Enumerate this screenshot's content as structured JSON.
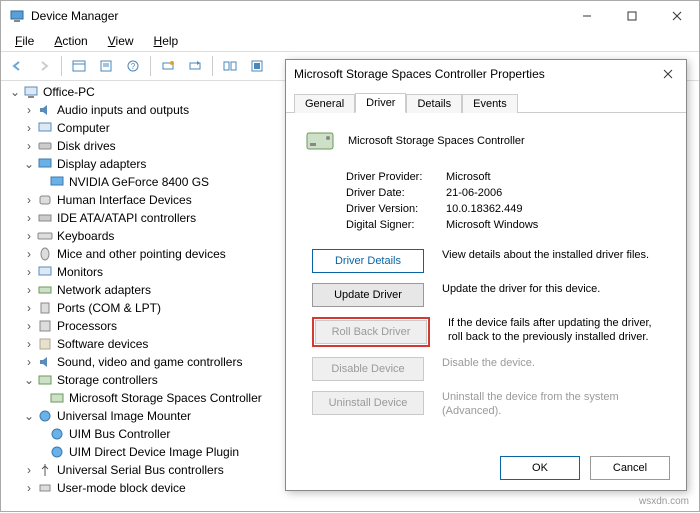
{
  "window": {
    "title": "Device Manager"
  },
  "menubar": {
    "file": "File",
    "action": "Action",
    "view": "View",
    "help": "Help"
  },
  "tree": {
    "root": "Office-PC",
    "items": [
      "Audio inputs and outputs",
      "Computer",
      "Disk drives",
      "Display adapters",
      "NVIDIA GeForce 8400 GS",
      "Human Interface Devices",
      "IDE ATA/ATAPI controllers",
      "Keyboards",
      "Mice and other pointing devices",
      "Monitors",
      "Network adapters",
      "Ports (COM & LPT)",
      "Processors",
      "Software devices",
      "Sound, video and game controllers",
      "Storage controllers",
      "Microsoft Storage Spaces Controller",
      "Universal Image Mounter",
      "UIM Bus Controller",
      "UIM Direct Device Image Plugin",
      "Universal Serial Bus controllers",
      "User-mode block device"
    ]
  },
  "dialog": {
    "title": "Microsoft Storage Spaces Controller Properties",
    "tabs": {
      "general": "General",
      "driver": "Driver",
      "details": "Details",
      "events": "Events"
    },
    "device_name": "Microsoft Storage Spaces Controller",
    "provider_label": "Driver Provider:",
    "provider_value": "Microsoft",
    "date_label": "Driver Date:",
    "date_value": "21-06-2006",
    "version_label": "Driver Version:",
    "version_value": "10.0.18362.449",
    "signer_label": "Digital Signer:",
    "signer_value": "Microsoft Windows",
    "btn_details": "Driver Details",
    "txt_details": "View details about the installed driver files.",
    "btn_update": "Update Driver",
    "txt_update": "Update the driver for this device.",
    "btn_rollback": "Roll Back Driver",
    "txt_rollback": "If the device fails after updating the driver, roll back to the previously installed driver.",
    "btn_disable": "Disable Device",
    "txt_disable": "Disable the device.",
    "btn_uninstall": "Uninstall Device",
    "txt_uninstall": "Uninstall the device from the system (Advanced).",
    "ok": "OK",
    "cancel": "Cancel"
  },
  "watermark": "wsxdn.com"
}
